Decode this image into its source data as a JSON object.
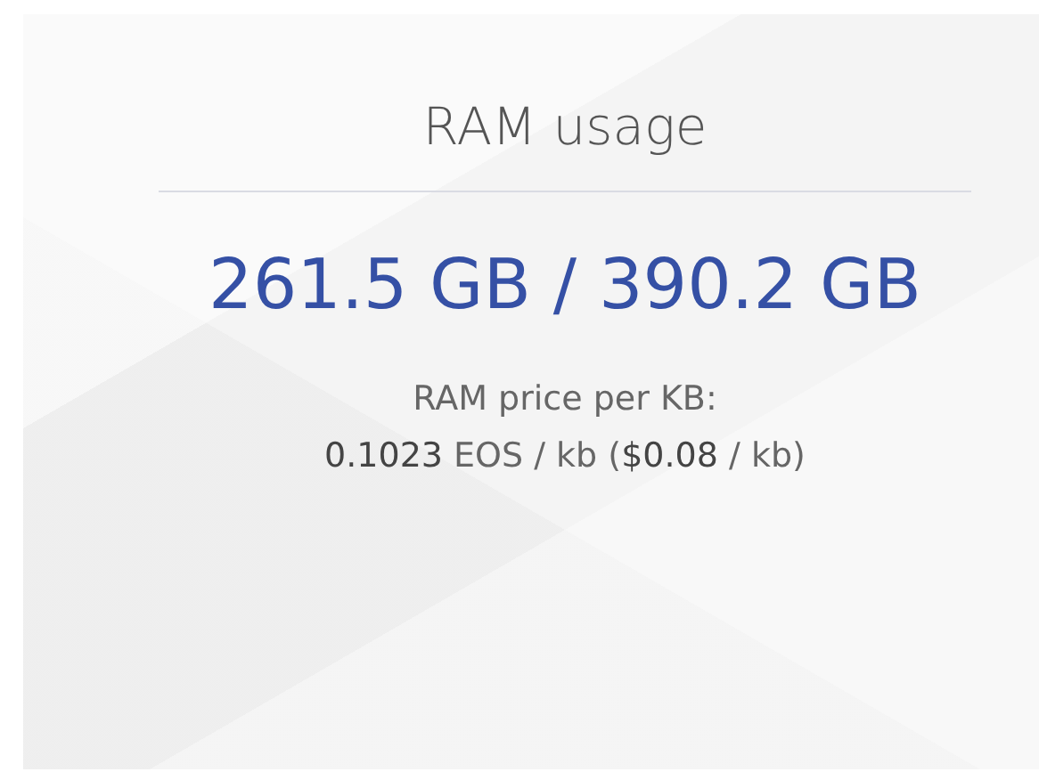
{
  "card": {
    "title": "RAM usage",
    "usage": "261.5 GB / 390.2 GB",
    "price_label": "RAM price per KB:",
    "price_value": "**0.1023** EOS / kb (**$0.08** / kb)"
  }
}
